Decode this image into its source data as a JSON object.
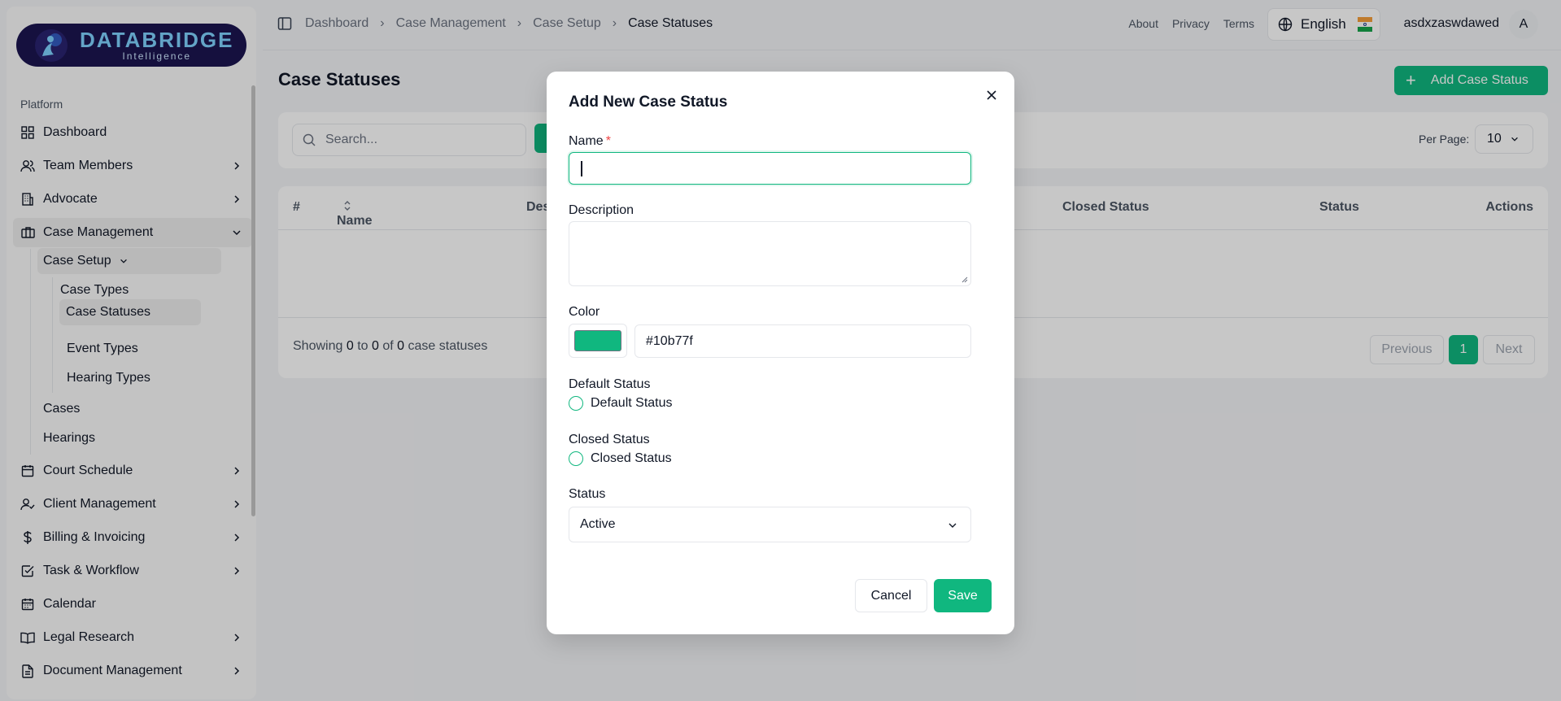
{
  "brand": {
    "name": "DATABRIDGE",
    "tagline": "Intelligence"
  },
  "sidebar": {
    "section": "Platform",
    "items": [
      {
        "label": "Dashboard",
        "icon": "grid-icon"
      },
      {
        "label": "Team Members",
        "icon": "users-icon"
      },
      {
        "label": "Advocate",
        "icon": "building-icon"
      },
      {
        "label": "Case Management",
        "icon": "briefcase-icon"
      },
      {
        "label": "Court Schedule",
        "icon": "calendar-icon"
      },
      {
        "label": "Client Management",
        "icon": "user-check-icon"
      },
      {
        "label": "Billing & Invoicing",
        "icon": "dollar-icon"
      },
      {
        "label": "Task & Workflow",
        "icon": "checkbox-icon"
      },
      {
        "label": "Calendar",
        "icon": "calendar-icon"
      },
      {
        "label": "Legal Research",
        "icon": "book-icon"
      },
      {
        "label": "Document Management",
        "icon": "document-icon"
      }
    ],
    "case_setup": "Case Setup",
    "case_setup_children": [
      "Case Types",
      "Case Statuses",
      "Event Types",
      "Hearing Types"
    ],
    "case_children": [
      "Cases",
      "Hearings"
    ]
  },
  "breadcrumb": [
    "Dashboard",
    "Case Management",
    "Case Setup",
    "Case Statuses"
  ],
  "header": {
    "links": [
      "About",
      "Privacy",
      "Terms"
    ],
    "language": "English",
    "username": "asdxzaswdawed",
    "avatar_initial": "A"
  },
  "page": {
    "title": "Case Statuses",
    "add_button": "Add Case Status",
    "search_placeholder": "Search...",
    "per_page_label": "Per Page:",
    "per_page_value": "10",
    "columns": [
      "#",
      "Name",
      "Des",
      "Closed Status",
      "Status",
      "Actions"
    ],
    "showing": {
      "prefix": "Showing",
      "from": "0",
      "to_word": "to",
      "to": "0",
      "of_word": "of",
      "total": "0",
      "suffix": "case statuses"
    },
    "pagination": {
      "previous": "Previous",
      "page": "1",
      "next": "Next"
    }
  },
  "modal": {
    "title": "Add New Case Status",
    "name_label": "Name",
    "required_mark": "*",
    "name_value": "",
    "description_label": "Description",
    "description_value": "",
    "color_label": "Color",
    "color_value": "#10b77f",
    "default_label": "Default Status",
    "default_checkbox": "Default Status",
    "closed_label": "Closed Status",
    "closed_checkbox": "Closed Status",
    "status_label": "Status",
    "status_value": "Active",
    "cancel": "Cancel",
    "save": "Save"
  },
  "colors": {
    "accent": "#10b77f",
    "brand_bg": "#1b1550",
    "brand_text": "#7fd3ff"
  }
}
